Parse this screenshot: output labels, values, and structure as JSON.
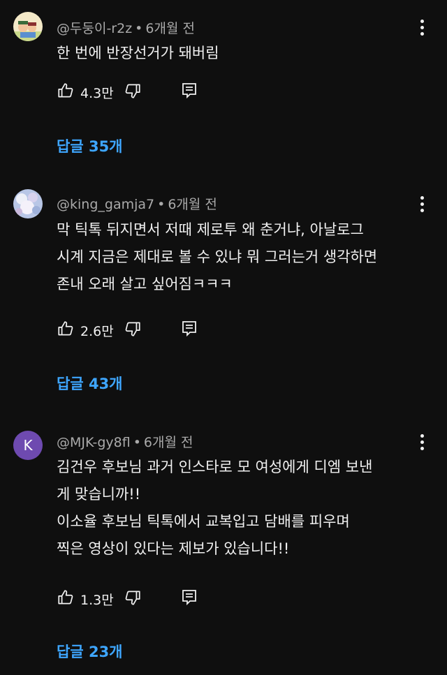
{
  "comments": [
    {
      "handle": "@두둥이-r2z",
      "time": "6개월 전",
      "lines": [
        "한 번에 반장선거가 돼버림"
      ],
      "likes": "4.3만",
      "replies": "답글 35개",
      "avatar_icon": "cartoon-avatar"
    },
    {
      "handle": "@king_gamja7",
      "time": "6개월 전",
      "lines": [
        "막 틱톡 뒤지면서 저때 제로투 왜 춘거냐, 아날로그",
        "시계 지금은 제대로 볼 수 있냐 뭐 그러는거 생각하면",
        "존내 오래 살고 싶어짐ㅋㅋㅋ"
      ],
      "likes": "2.6만",
      "replies": "답글 43개",
      "avatar_icon": "photo-avatar"
    },
    {
      "handle": "@MJK-gy8fl",
      "time": "6개월 전",
      "lines": [
        "김건우 후보님 과거 인스타로 모 여성에게 디엠 보낸",
        "게 맞습니까!!",
        "이소율 후보님 틱톡에서 교복입고 담배를 피우며",
        "찍은 영상이 있다는 제보가 있습니다!!"
      ],
      "likes": "1.3만",
      "replies": "답글 23개",
      "avatar_letter": "K",
      "avatar_color": "#6e4ab0"
    }
  ],
  "colors": {
    "background": "#0f0f0f",
    "text": "#f1f1f1",
    "meta": "#aaaaaa",
    "reply_link": "#3ea6ff"
  }
}
